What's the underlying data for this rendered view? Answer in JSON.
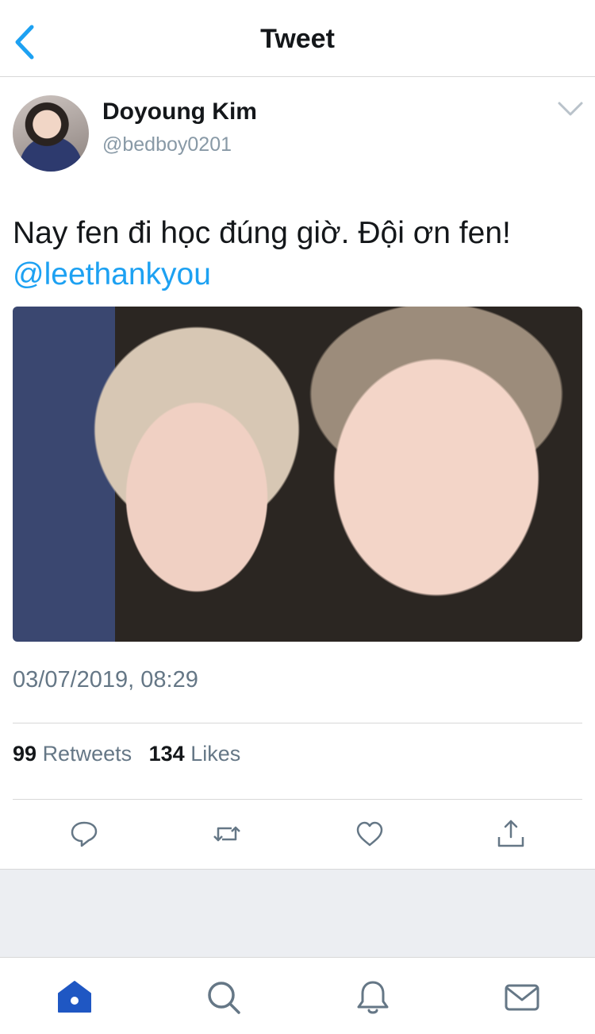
{
  "header": {
    "title": "Tweet",
    "back_icon": "chevron-left-icon"
  },
  "tweet": {
    "author_name": "Doyoung Kim",
    "author_handle": "@bedboy0201",
    "text": "Nay fen đi học đúng giờ. Đội ơn fen!",
    "mention": "@leethankyou",
    "timestamp": "03/07/2019, 08:29",
    "retweet_count": "99",
    "retweet_label": "Retweets",
    "like_count": "134",
    "like_label": "Likes"
  },
  "actions": [
    "reply-icon",
    "retweet-icon",
    "like-icon",
    "share-icon"
  ],
  "tabs": [
    "home-icon",
    "search-icon",
    "notifications-icon",
    "messages-icon"
  ],
  "colors": {
    "accent": "#1da1f2",
    "active_tab": "#1f57c3",
    "icon_gray": "#657786",
    "text": "#14171a"
  }
}
